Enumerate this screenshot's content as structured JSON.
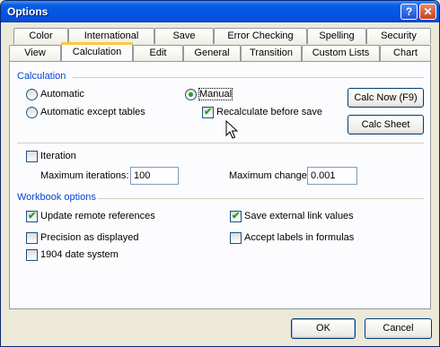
{
  "window": {
    "title": "Options",
    "help_btn": "?",
    "close_btn": "✕"
  },
  "tabs_row1": [
    "Color",
    "International",
    "Save",
    "Error Checking",
    "Spelling",
    "Security"
  ],
  "tabs_row2": [
    "View",
    "Calculation",
    "Edit",
    "General",
    "Transition",
    "Custom Lists",
    "Chart"
  ],
  "active_tab": "Calculation",
  "calculation": {
    "group_label": "Calculation",
    "automatic": "Automatic",
    "automatic_except_tables": "Automatic except tables",
    "manual": "Manual",
    "selected": "Manual",
    "recalc_before_save": "Recalculate before save",
    "recalc_before_save_checked": true,
    "calc_now": "Calc Now (F9)",
    "calc_sheet": "Calc Sheet",
    "iteration": "Iteration",
    "iteration_checked": false,
    "max_iterations_label": "Maximum iterations:",
    "max_iterations_value": "100",
    "max_change_label": "Maximum change:",
    "max_change_value": "0.001"
  },
  "workbook": {
    "group_label": "Workbook options",
    "update_remote": "Update remote references",
    "update_remote_checked": true,
    "precision": "Precision as displayed",
    "precision_checked": false,
    "date_1904": "1904 date system",
    "date_1904_checked": false,
    "save_external": "Save external link values",
    "save_external_checked": true,
    "accept_labels": "Accept labels in formulas",
    "accept_labels_checked": false
  },
  "footer": {
    "ok": "OK",
    "cancel": "Cancel"
  }
}
